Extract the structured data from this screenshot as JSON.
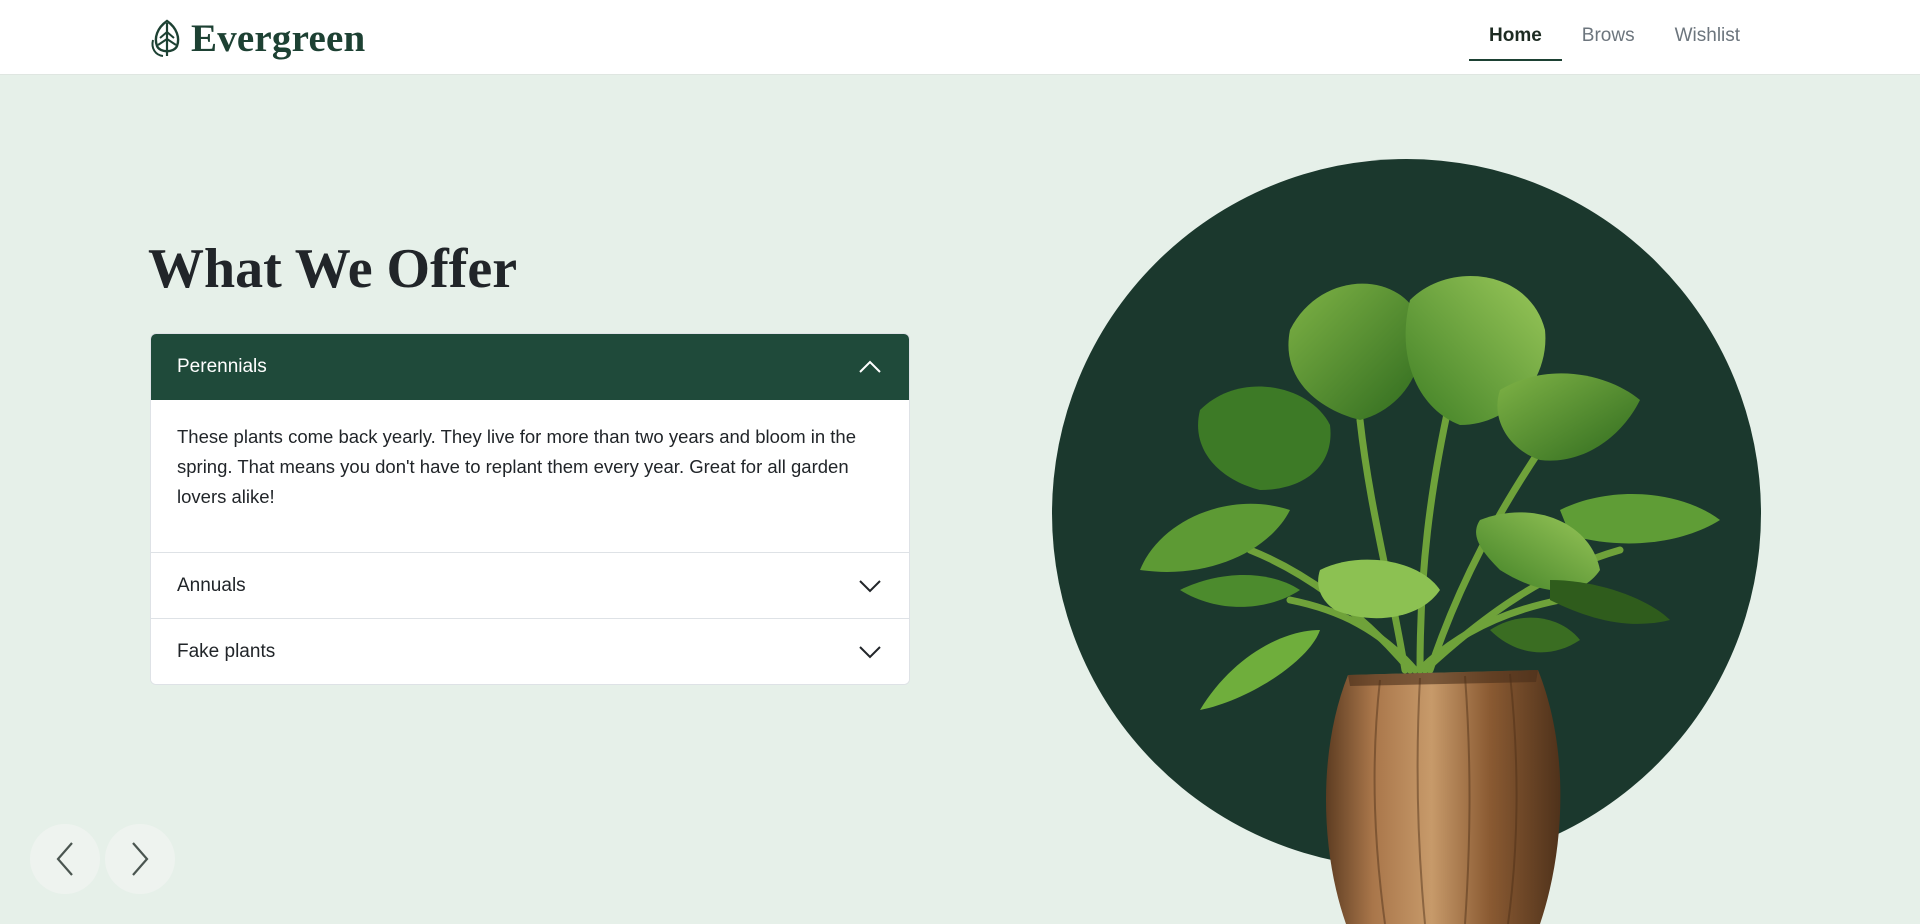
{
  "brand": {
    "name": "Evergreen",
    "logo_icon": "leaf-icon"
  },
  "nav": {
    "items": [
      {
        "label": "Home",
        "active": true
      },
      {
        "label": "Brows",
        "active": false
      },
      {
        "label": "Wishlist",
        "active": false
      }
    ]
  },
  "section": {
    "title": "What We Offer"
  },
  "accordion": {
    "items": [
      {
        "title": "Perennials",
        "expanded": true,
        "icon": "chevron-up-icon",
        "body": "These plants come back yearly. They live for more than two years and bloom in the spring. That means you don't have to replant them every year. Great for all garden lovers alike!"
      },
      {
        "title": "Annuals",
        "expanded": false,
        "icon": "chevron-down-icon"
      },
      {
        "title": "Fake plants",
        "expanded": false,
        "icon": "chevron-down-icon"
      }
    ]
  },
  "hero_image": {
    "subject": "potted-plant-image"
  },
  "carousel": {
    "prev_icon": "chevron-left-icon",
    "next_icon": "chevron-right-icon"
  },
  "colors": {
    "page_background": "#e6f0e9",
    "brand_green": "#1d4133",
    "accordion_header_active": "#1f4a3a",
    "circle": "#1b382d"
  }
}
